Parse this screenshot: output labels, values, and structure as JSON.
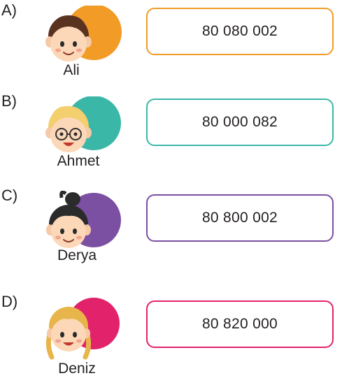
{
  "options": [
    {
      "letter": "A)",
      "name": "Ali",
      "number": "80 080 002",
      "color": "#f29b26"
    },
    {
      "letter": "B)",
      "name": "Ahmet",
      "number": "80 000 082",
      "color": "#3bb7a8"
    },
    {
      "letter": "C)",
      "name": "Derya",
      "number": "80 800 002",
      "color": "#7b4fa2"
    },
    {
      "letter": "D)",
      "name": "Deniz",
      "number": "80 820 000",
      "color": "#e2226a"
    }
  ]
}
